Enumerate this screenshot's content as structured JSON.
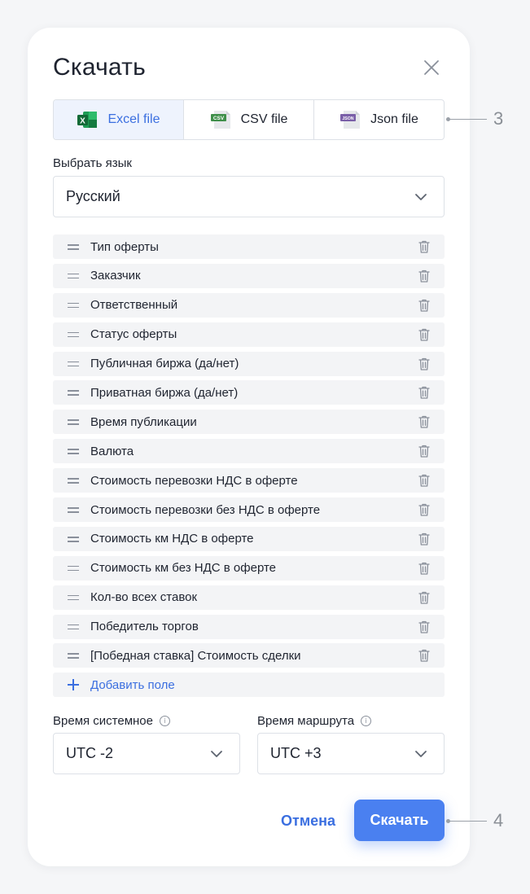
{
  "dialog": {
    "title": "Скачать",
    "close_icon": "close-icon"
  },
  "format_tabs": [
    {
      "label": "Excel file",
      "icon": "excel-file-icon",
      "badge": "X",
      "active": true
    },
    {
      "label": "CSV file",
      "icon": "csv-file-icon",
      "badge": "CSV",
      "active": false
    },
    {
      "label": "Json file",
      "icon": "json-file-icon",
      "badge": "JSON",
      "active": false
    }
  ],
  "language": {
    "label": "Выбрать язык",
    "value": "Русский"
  },
  "fields": [
    "Тип оферты",
    "Заказчик",
    "Ответственный",
    "Статус оферты",
    "Публичная биржа (да/нет)",
    "Приватная биржа (да/нет)",
    "Время публикации",
    "Валюта",
    "Стоимость перевозки НДС в оферте",
    "Стоимость перевозки без НДС в оферте",
    "Стоимость км НДС в оферте",
    "Стоимость км без НДС в оферте",
    "Кол-во всех ставок",
    "Победитель торгов",
    "[Победная ставка] Стоимость сделки"
  ],
  "add_field_label": "Добавить поле",
  "system_time": {
    "label": "Время системное",
    "value": "UTC -2"
  },
  "route_time": {
    "label": "Время маршрута",
    "value": "UTC +3"
  },
  "actions": {
    "cancel": "Отмена",
    "download": "Скачать"
  },
  "callouts": {
    "tabs_marker": "3",
    "download_marker": "4"
  },
  "colors": {
    "accent": "#4a80f0",
    "link": "#3b6fe0",
    "active_tab_bg": "#eef3fd",
    "field_bg": "#f3f4f6",
    "excel": "#1f7a45",
    "csv": "#3f8f4a",
    "json": "#7a5fa8"
  }
}
